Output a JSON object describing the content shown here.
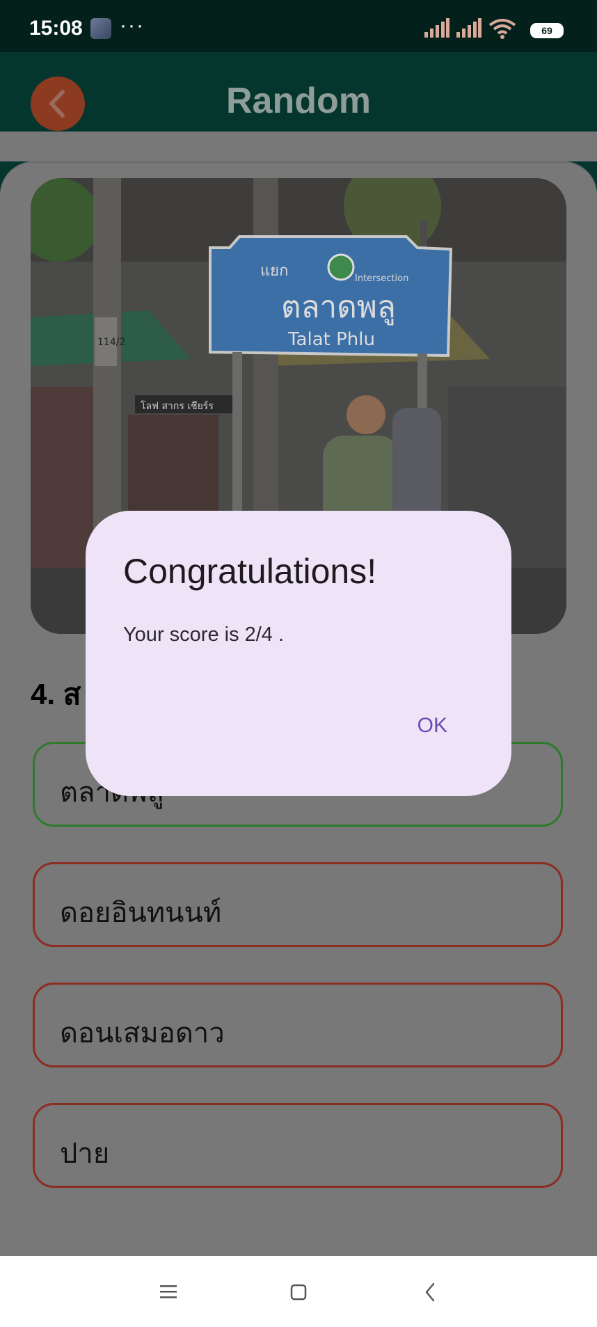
{
  "status_bar": {
    "time": "15:08",
    "dots": "···",
    "battery": "69"
  },
  "app_bar": {
    "title": "Random"
  },
  "question": {
    "text": "4. ส"
  },
  "answers": [
    {
      "label": "ตลาดพลู",
      "state": "correct"
    },
    {
      "label": "ดอยอินทนนท์",
      "state": "wrong"
    },
    {
      "label": "ดอนเสมอดาว",
      "state": "wrong"
    },
    {
      "label": "ปาย",
      "state": "wrong"
    }
  ],
  "photo": {
    "sign_line1": "แยก",
    "sign_line1b": "Intersection",
    "sign_thai": "ตลาดพลู",
    "sign_english": "Talat Phlu",
    "pole_label": "114/2",
    "shop_sign": "โลฟ สากร เชียร์ร"
  },
  "dialog": {
    "title": "Congratulations!",
    "body": "Your score is 2/4 .",
    "ok_label": "OK"
  },
  "colors": {
    "status_bg": "#03201b",
    "app_bar_bg": "#05362d",
    "back_button": "#8c3a20",
    "dialog_bg": "#efe4f7",
    "accent": "#6a4bb3",
    "correct_border": "#2f7a2b",
    "wrong_border": "#8c2d22"
  }
}
